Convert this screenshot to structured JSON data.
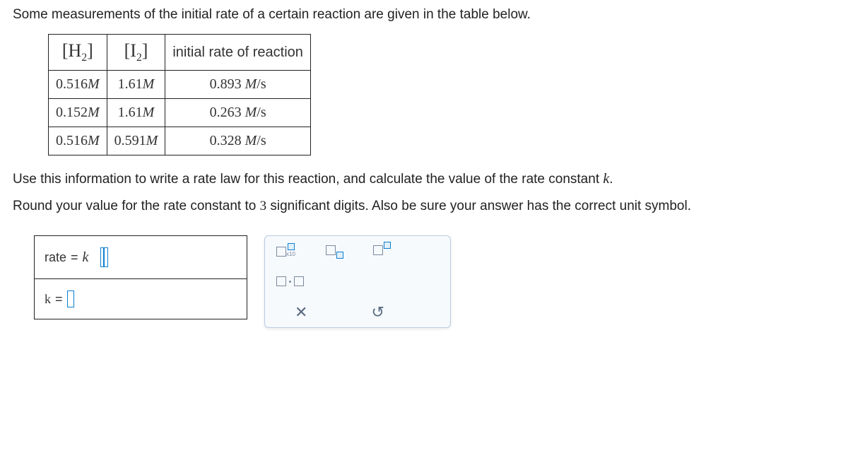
{
  "intro_text": "Some measurements of the initial rate of a certain reaction are given in the table below.",
  "headers": {
    "h2": "H",
    "h2_sub": "2",
    "i2": "I",
    "i2_sub": "2",
    "rate": "initial rate of reaction"
  },
  "rows": [
    {
      "h2_val": "0.516",
      "h2_unit": "M",
      "i2_val": "1.61",
      "i2_unit": "M",
      "rate_val": "0.893",
      "rate_unit": "M/s"
    },
    {
      "h2_val": "0.152",
      "h2_unit": "M",
      "i2_val": "1.61",
      "i2_unit": "M",
      "rate_val": "0.263",
      "rate_unit": "M/s"
    },
    {
      "h2_val": "0.516",
      "h2_unit": "M",
      "i2_val": "0.591",
      "i2_unit": "M",
      "rate_val": "0.328",
      "rate_unit": "M/s"
    }
  ],
  "instr1_a": "Use this information to write a rate law for this reaction, and calculate the value of the rate constant ",
  "instr1_k": "k",
  "instr1_b": ".",
  "instr2_a": "Round your value for the rate constant to ",
  "instr2_n": "3",
  "instr2_b": " significant digits. Also be sure your answer has the correct unit symbol.",
  "answer": {
    "rate_label": "rate",
    "equals": " = ",
    "k_sym": "k",
    "k_label": "k",
    "equals2": " = "
  },
  "palette": {
    "x10": "x10",
    "clear": "✕",
    "reset": "↺"
  }
}
